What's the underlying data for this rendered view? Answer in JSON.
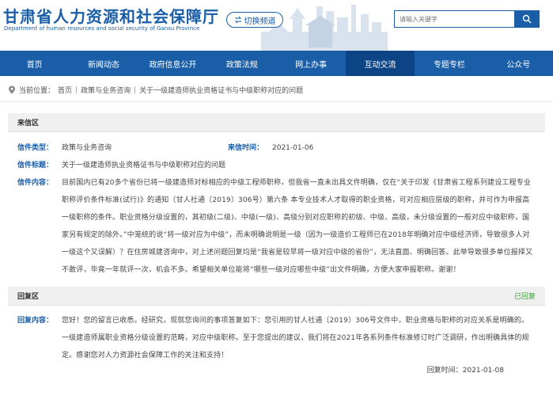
{
  "header": {
    "title_cn": "甘肃省人力资源和社会保障厅",
    "title_en": "Department of human resources and social security of Gansu Province",
    "switch_label": "切换频道",
    "search_placeholder": "请输入关键字"
  },
  "nav": {
    "items": [
      {
        "label": "首页"
      },
      {
        "label": "新闻动态"
      },
      {
        "label": "政府信息公开"
      },
      {
        "label": "政策法规"
      },
      {
        "label": "网上办事"
      },
      {
        "label": "互动交流"
      },
      {
        "label": "专题专栏"
      },
      {
        "label": "公众号"
      }
    ],
    "active_index": 5
  },
  "breadcrumb": {
    "prefix": "当前位置：",
    "items": [
      "首页",
      "政策与业务咨询",
      "关于一级建造师执业资格证书与中级职称对应的问题"
    ]
  },
  "letter": {
    "section_title": "来信区",
    "type_label": "信件类型：",
    "type_value": "政策与业务咨询",
    "date_label": "来信时间：",
    "date_value": "2021-01-06",
    "title_label": "信件标题：",
    "title_value": "关于一级建造师执业资格证书与中级职称对应的问题",
    "content_label": "信件内容：",
    "content_value": "目前国内已有20多个省份已将一级建造师对标相应的中级工程师职称，但我省一直未出具文件明确，仅在“关于印发《甘肃省工程系列建设工程专业职称评价条件标准(试行)》的通知（甘人社通〔2019〕306号）第六条 本专业技术人才取得的职业资格，可对应相应层级的职称，并可作为申报高一级职称的条件。职业资格分级设置的，其初级(二级)、中级(一级)、高级分别对应职称的初级、中级、高级，未分级设置的一般对应中级职称，国家另有规定的除外。”中笼统的说“将一级对应为中级”，而未明确说明是一级（因为一级造价工程师已在2018年明确对应中级经济师，导致很多人对一级这个又误解）？在住房城建咨询中，对上述问题回复均是“我省是较早将一级对应中级的省份”，无法直面、明确回答。此举导致很多单位报择又不敢评，毕竟一年就评一次，机会不多。希望相关单位能将“哪些一级对应哪些中级”出文件明确，方便大家申报职称。谢谢！"
  },
  "reply": {
    "section_title": "回复区",
    "status": "已回复",
    "content_label": "回复内容：",
    "content_value": "您好！您的留言已收悉。经研究，现就您询问的事项答复如下：您引用的甘人社通〔2019〕306号文件中，职业资格与职称的对应关系是明确的。一级建造师属职业资格分级设置的范畴，对应中级职称。至于您提出的建议，我们将在2021年各系列条件标准修订时广泛调研，作出明确具体的规定。感谢您对人力资源社会保障工作的关注和支持！",
    "date_label": "回复时间：",
    "date_value": "2021-01-08"
  },
  "colors": {
    "primary": "#1a5ea8",
    "nav_active": "#0c4486",
    "status_green": "#3aa03a"
  }
}
